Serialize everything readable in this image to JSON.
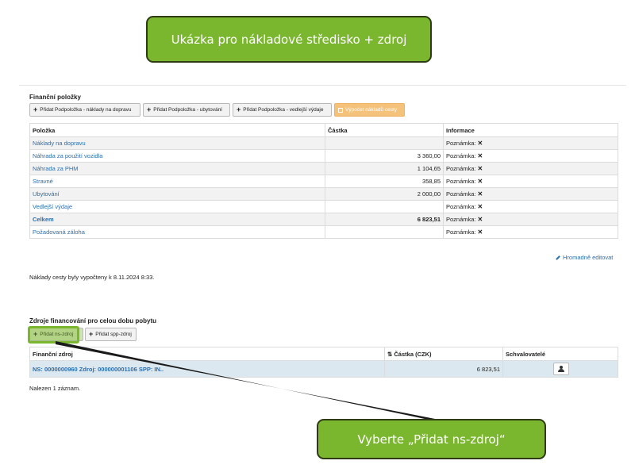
{
  "callouts": {
    "top": "Ukázka pro nákladové středisko + zdroj",
    "bottom": "Vyberte „Přidat ns-zdroj“"
  },
  "financni_polozky": {
    "title": "Finanční položky",
    "buttons": [
      "Přidat Podpoložka - náklady na dopravu",
      "Přidat Podpoložka - ubytování",
      "Přidat Podpoložka - vedlejší výdaje"
    ],
    "calc_button": "Výpočet nákladů cesty",
    "columns": [
      "Položka",
      "Částka",
      "Informace"
    ],
    "rows": [
      {
        "name": "Náklady na dopravu",
        "amount": "",
        "info": "Poznámka:"
      },
      {
        "name": "Náhrada za použití vozidla",
        "amount": "3 360,00",
        "info": "Poznámka:"
      },
      {
        "name": "Náhrada za PHM",
        "amount": "1 104,65",
        "info": "Poznámka:"
      },
      {
        "name": "Stravné",
        "amount": "358,85",
        "info": "Poznámka:"
      },
      {
        "name": "Ubytování",
        "amount": "2 000,00",
        "info": "Poznámka:"
      },
      {
        "name": "Vedlejší výdaje",
        "amount": "",
        "info": "Poznámka:"
      },
      {
        "name": "Celkem",
        "amount": "6 823,51",
        "info": "Poznámka:"
      },
      {
        "name": "Požadovaná záloha",
        "amount": "",
        "info": "Poznámka:"
      }
    ],
    "bulk_edit": "Hromadně editovat",
    "calc_note": "Náklady cesty byly vypočteny k 8.11.2024 8:33."
  },
  "zdroje": {
    "title": "Zdroje financování pro celou dobu pobytu",
    "btn_ns": "Přidat ns-zdroj",
    "btn_spp": "Přidat spp-zdroj",
    "columns": [
      "Finanční zdroj",
      "Částka (CZK)",
      "Schvalovatelé"
    ],
    "sort_icon": "sort-icon",
    "row": {
      "source": "NS: 0000000960  Zdroj: 000000001106  SPP: IN..",
      "amount": "6 823,51"
    },
    "footer": "Nalezen 1 záznam."
  }
}
